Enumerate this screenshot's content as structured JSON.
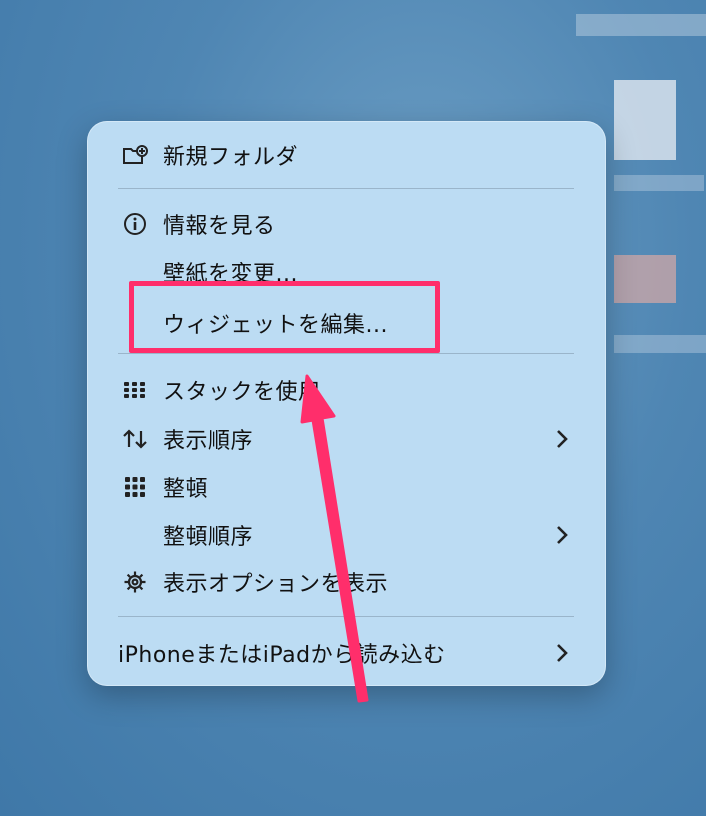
{
  "menu": {
    "items": [
      {
        "label": "新規フォルダ",
        "icon": "new-folder-icon"
      },
      {
        "label": "情報を見る",
        "icon": "info-icon"
      },
      {
        "label": "壁紙を変更..."
      },
      {
        "label": "ウィジェットを編集..."
      },
      {
        "label": "スタックを使用",
        "icon": "stack-icon"
      },
      {
        "label": "表示順序",
        "icon": "sort-order-icon",
        "submenu": true
      },
      {
        "label": "整頓",
        "icon": "grid-icon"
      },
      {
        "label": "整頓順序",
        "submenu": true
      },
      {
        "label": "表示オプションを表示",
        "icon": "gear-icon"
      },
      {
        "label": "iPhoneまたはiPadから読み込む",
        "submenu": true
      }
    ]
  },
  "annotation": {
    "highlight_color": "#ff2e6b",
    "target": "ウィジェットを編集..."
  },
  "colors": {
    "menu_background": "#bcdcf3",
    "desktop_background": "#4f86b3"
  }
}
